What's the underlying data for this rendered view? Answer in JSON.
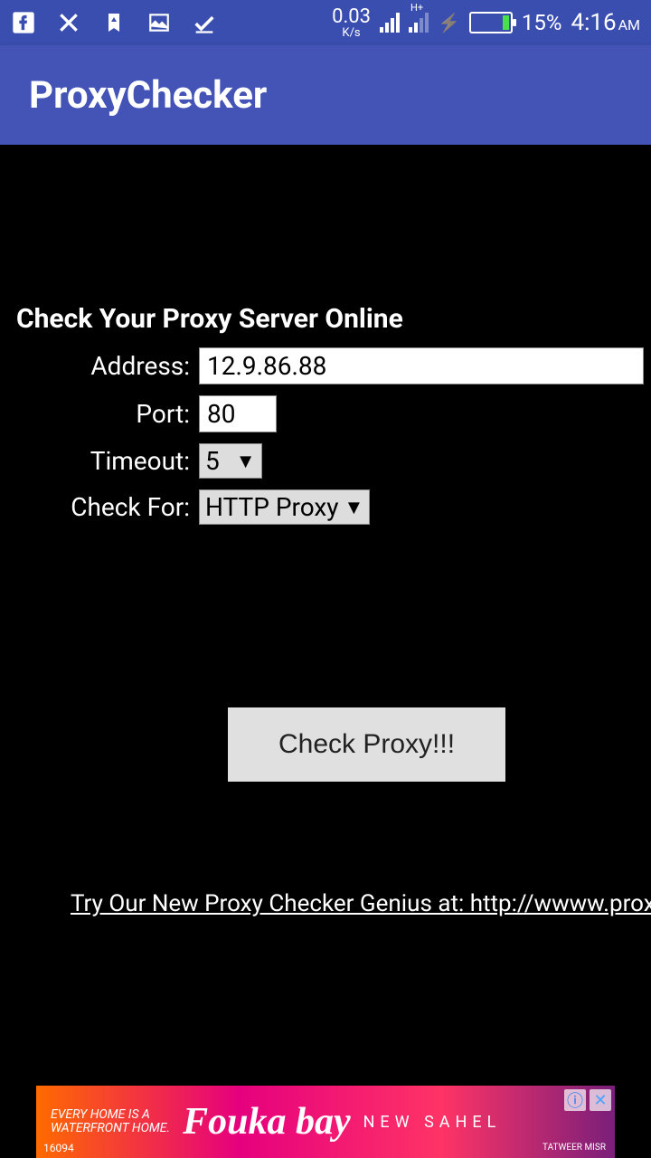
{
  "status": {
    "net_speed": "0.03",
    "net_unit": "K/s",
    "battery_pct": "15%",
    "time": "4:16",
    "ampm": "AM"
  },
  "app": {
    "title": "ProxyChecker"
  },
  "main": {
    "heading": "Check Your Proxy Server Online",
    "labels": {
      "address": "Address:",
      "port": "Port:",
      "timeout": "Timeout:",
      "check_for": "Check For:"
    },
    "values": {
      "address": "12.9.86.88",
      "port": "80",
      "timeout": "5",
      "check_for": "HTTP Proxy"
    },
    "button": "Check Proxy!!!",
    "promo": "Try Our New Proxy Checker Genius at: http://wwww.proxychecker."
  },
  "ad": {
    "line1": "EVERY HOME IS A",
    "line2": "WATERFRONT HOME.",
    "script": "Fouka bay",
    "right": "NEW SAHEL",
    "num": "16094",
    "brand": "TATWEER MISR"
  }
}
